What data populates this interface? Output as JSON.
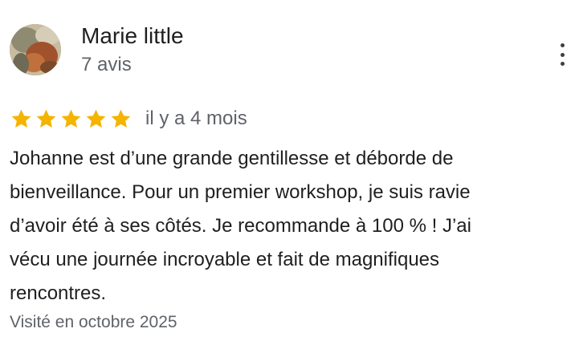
{
  "author": {
    "name": "Marie little",
    "reviews_count": "7 avis",
    "avatar_icon": "profile-photo"
  },
  "menu": {
    "icon": "more-vertical-icon"
  },
  "rating": {
    "value": 5,
    "max": 5,
    "star_color": "#f4b400",
    "relative_date": "il y a 4 mois"
  },
  "review": {
    "lines": [
      "Johanne est d’une grande gentillesse et déborde de",
      "bienveillance. Pour un premier workshop, je suis ravie",
      "d’avoir été à ses côtés. Je recommande à 100 % ! J’ai",
      "vécu une journée incroyable et fait de magnifiques",
      "rencontres."
    ],
    "visited": "Visité en octobre 2025"
  }
}
